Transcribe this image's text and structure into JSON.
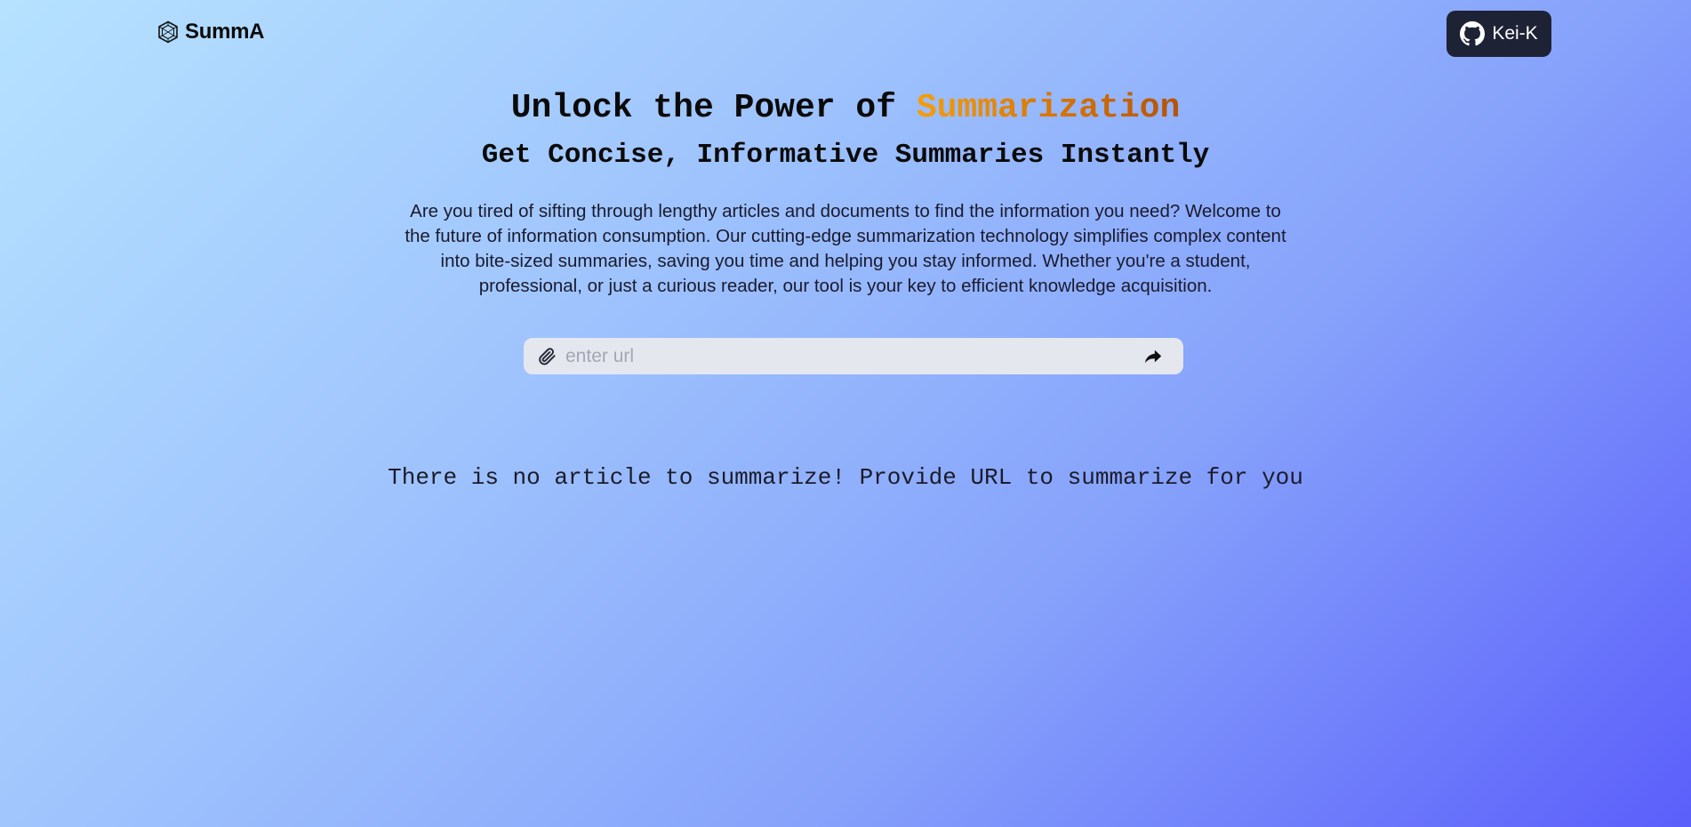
{
  "nav": {
    "brand_name": "SummA",
    "brand_icon": "hexagon-logo-icon",
    "github_button": {
      "label": "Kei-K",
      "icon": "github-icon"
    }
  },
  "hero": {
    "headline_prefix": "Unlock the Power of ",
    "headline_accent": "Summarization",
    "subheadline": "Get Concise, Informative Summaries Instantly",
    "description": "Are you tired of sifting through lengthy articles and documents to find the information you need? Welcome to the future of information consumption. Our cutting-edge summarization technology simplifies complex content into bite-sized summaries, saving you time and helping you stay informed. Whether you're a student, professional, or just a curious reader, our tool is your key to efficient knowledge acquisition."
  },
  "url_form": {
    "placeholder": "enter url",
    "value": "",
    "leading_icon": "paperclip-icon",
    "submit_icon": "share-arrow-icon"
  },
  "results": {
    "empty_message": "There is no article to summarize! Provide URL to summarize for you"
  },
  "colors": {
    "background_start": "#b6e2ff",
    "background_end": "#5b5ffb",
    "accent": "#d97706",
    "button_dark": "#1e2235",
    "input_bg": "#e5e7ef"
  }
}
